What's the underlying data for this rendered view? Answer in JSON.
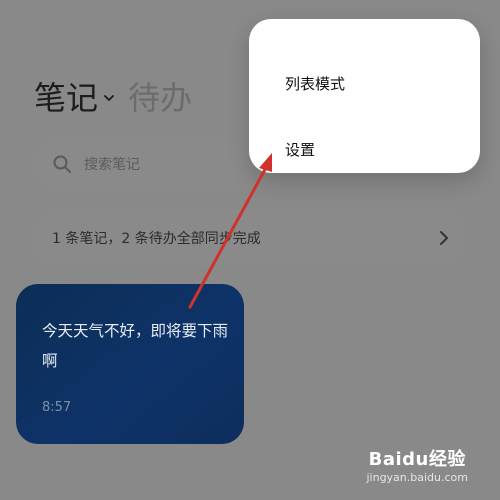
{
  "header": {
    "tabs": [
      {
        "label": "笔记",
        "active": true
      },
      {
        "label": "待办",
        "active": false
      }
    ],
    "dropdown_icon": "chevron-down-icon"
  },
  "search": {
    "placeholder": "搜索笔记",
    "icon": "search-icon"
  },
  "sync_banner": {
    "text": "1 条笔记，2 条待办全部同步完成",
    "icon": "chevron-right-icon"
  },
  "notes": [
    {
      "title": "今天天气不好，即将要下雨啊",
      "time": "8:57",
      "color": "#0e3368"
    }
  ],
  "menu": {
    "items": [
      {
        "label": "列表模式"
      },
      {
        "label": "设置"
      }
    ]
  },
  "annotation": {
    "arrow_color": "#d0322b"
  },
  "watermark": {
    "main": "Baidu经验",
    "sub": "jingyan.baidu.com"
  }
}
